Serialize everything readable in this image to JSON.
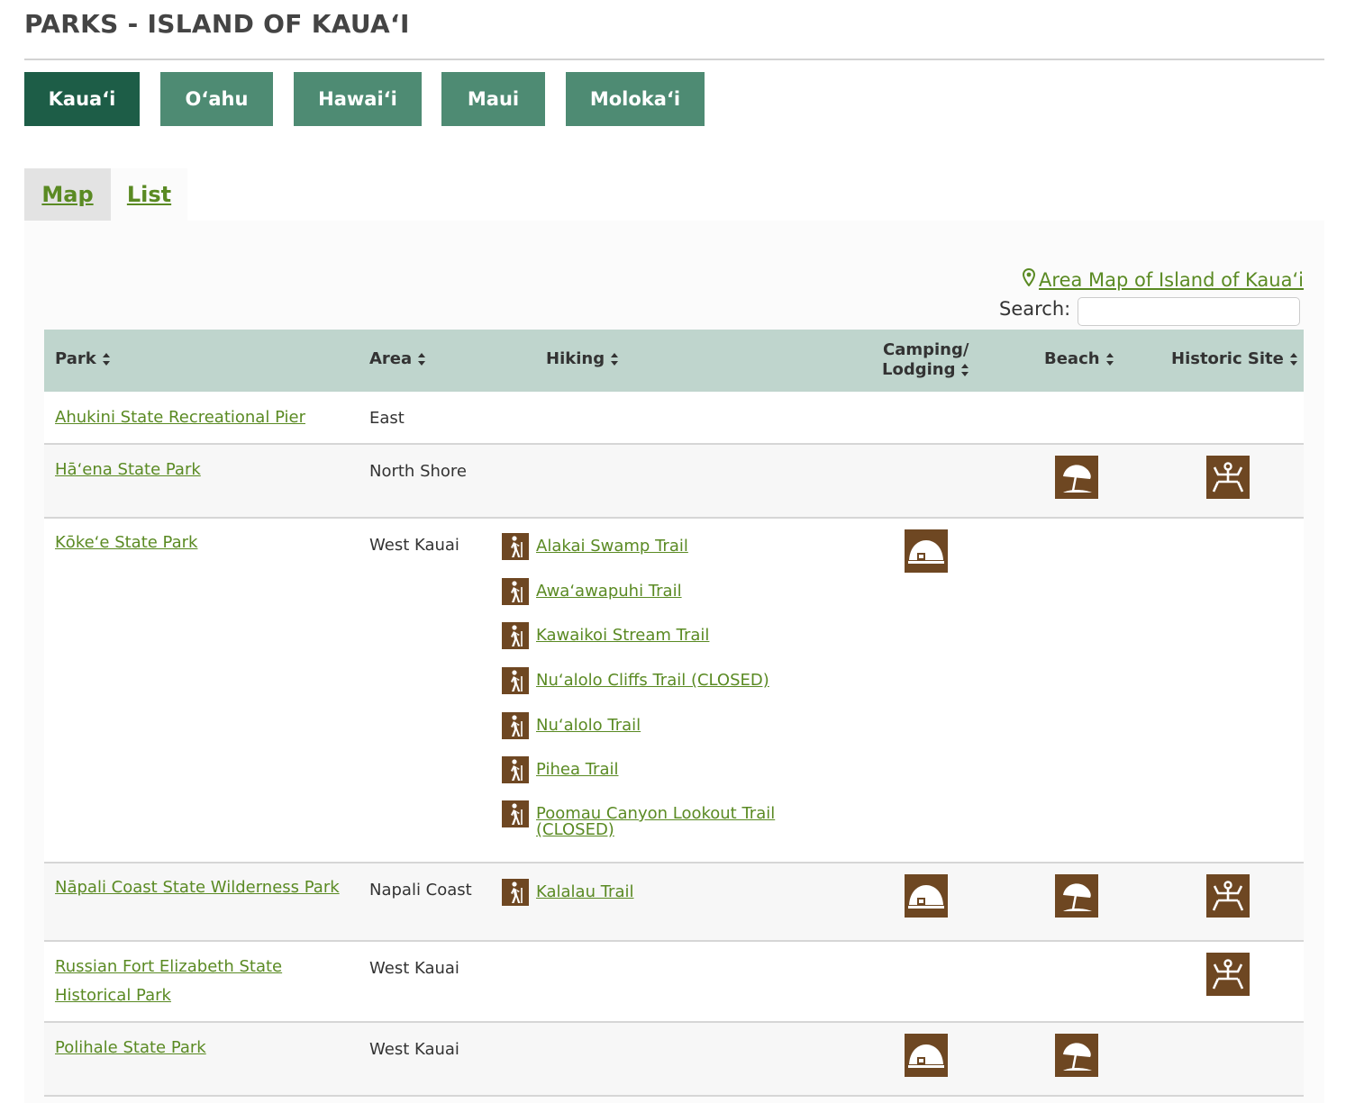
{
  "page": {
    "title": "PARKS - ISLAND OF KAUAʻI"
  },
  "islands": [
    {
      "label": "Kauaʻi",
      "active": true
    },
    {
      "label": "Oʻahu",
      "active": false
    },
    {
      "label": "Hawaiʻi",
      "active": false
    },
    {
      "label": "Maui",
      "active": false
    },
    {
      "label": "Molokaʻi",
      "active": false
    }
  ],
  "view_tabs": {
    "map": "Map",
    "list": "List"
  },
  "area_map_link": "Area Map of Island of Kauaʻi",
  "search": {
    "label": "Search:",
    "value": "",
    "placeholder": ""
  },
  "table": {
    "headers": {
      "park": "Park",
      "area": "Area",
      "hiking": "Hiking",
      "camping_line1": "Camping/",
      "camping_line2": "Lodging",
      "beach": "Beach",
      "historic": "Historic Site"
    },
    "rows": [
      {
        "park": "Ahukini State Recreational Pier",
        "area": "East",
        "trails": [],
        "camping": false,
        "beach": false,
        "historic": false
      },
      {
        "park": "Hāʻena State Park",
        "area": "North Shore",
        "trails": [],
        "camping": false,
        "beach": true,
        "historic": true
      },
      {
        "park": "Kōkeʻe State Park",
        "area": "West Kauai",
        "trails": [
          "Alakai Swamp Trail",
          "Awaʻawapuhi Trail",
          "Kawaikoi Stream Trail",
          "Nuʻalolo Cliffs Trail (CLOSED)",
          "Nuʻalolo Trail",
          "Pihea Trail",
          "Poomau Canyon Lookout Trail (CLOSED)"
        ],
        "camping": true,
        "beach": false,
        "historic": false
      },
      {
        "park": "Nāpali Coast State Wilderness Park",
        "area": "Napali Coast",
        "trails": [
          "Kalalau Trail"
        ],
        "camping": true,
        "beach": true,
        "historic": true
      },
      {
        "park": "Russian Fort Elizabeth State Historical Park",
        "area": "West Kauai",
        "trails": [],
        "camping": false,
        "beach": false,
        "historic": true
      },
      {
        "park": "Polihale State Park",
        "area": "West Kauai",
        "trails": [],
        "camping": true,
        "beach": true,
        "historic": false
      }
    ]
  },
  "icons": {
    "hiking": "hiker-icon",
    "camping": "tent-icon",
    "beach": "beach-umbrella-icon",
    "historic": "petroglyph-icon",
    "sort": "sort-icon",
    "map_marker": "map-marker-icon"
  },
  "colors": {
    "active_tab": "#1d5d47",
    "tab": "#4e8b73",
    "link": "#5a8a23",
    "table_header": "#bfd5cd",
    "icon_bg": "#6e4722"
  }
}
